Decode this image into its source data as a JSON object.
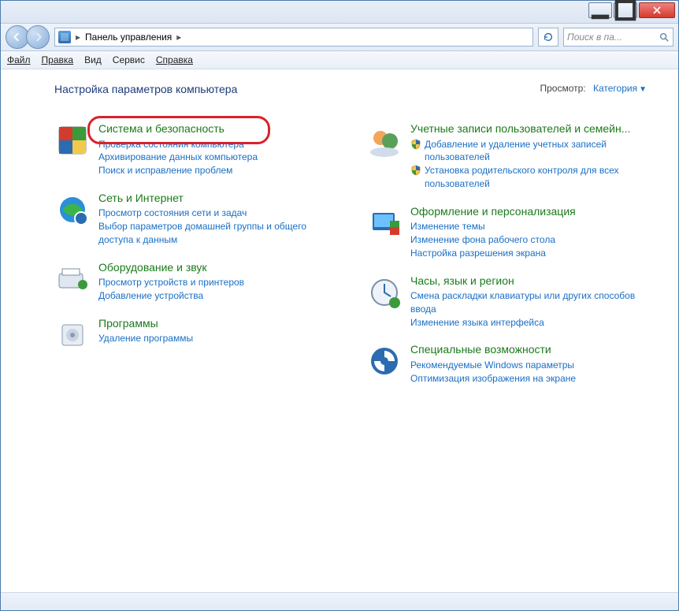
{
  "titlebar": {},
  "address": {
    "root": "Панель управления",
    "sep": "▸"
  },
  "search": {
    "placeholder": "Поиск в па..."
  },
  "menu": {
    "file": "Файл",
    "edit": "Правка",
    "view": "Вид",
    "tools": "Сервис",
    "help": "Справка"
  },
  "heading": "Настройка параметров компьютера",
  "view_label": "Просмотр:",
  "view_value": "Категория",
  "left": [
    {
      "title": "Система и безопасность",
      "highlight": true,
      "links": [
        "Проверка состояния компьютера",
        "Архивирование данных компьютера",
        "Поиск и исправление проблем"
      ]
    },
    {
      "title": "Сеть и Интернет",
      "links": [
        "Просмотр состояния сети и задач",
        "Выбор параметров домашней группы и общего доступа к данным"
      ]
    },
    {
      "title": "Оборудование и звук",
      "links": [
        "Просмотр устройств и принтеров",
        "Добавление устройства"
      ]
    },
    {
      "title": "Программы",
      "links": [
        "Удаление программы"
      ]
    }
  ],
  "right": [
    {
      "title": "Учетные записи пользователей и семейн...",
      "links": [
        {
          "t": "Добавление и удаление учетных записей пользователей",
          "shield": true
        },
        {
          "t": "Установка родительского контроля для всех пользователей",
          "shield": true
        }
      ]
    },
    {
      "title": "Оформление и персонализация",
      "links": [
        "Изменение темы",
        "Изменение фона рабочего стола",
        "Настройка разрешения экрана"
      ]
    },
    {
      "title": "Часы, язык и регион",
      "links": [
        "Смена раскладки клавиатуры или других способов ввода",
        "Изменение языка интерфейса"
      ]
    },
    {
      "title": "Специальные возможности",
      "links": [
        "Рекомендуемые Windows параметры",
        "Оптимизация изображения на экране"
      ]
    }
  ]
}
